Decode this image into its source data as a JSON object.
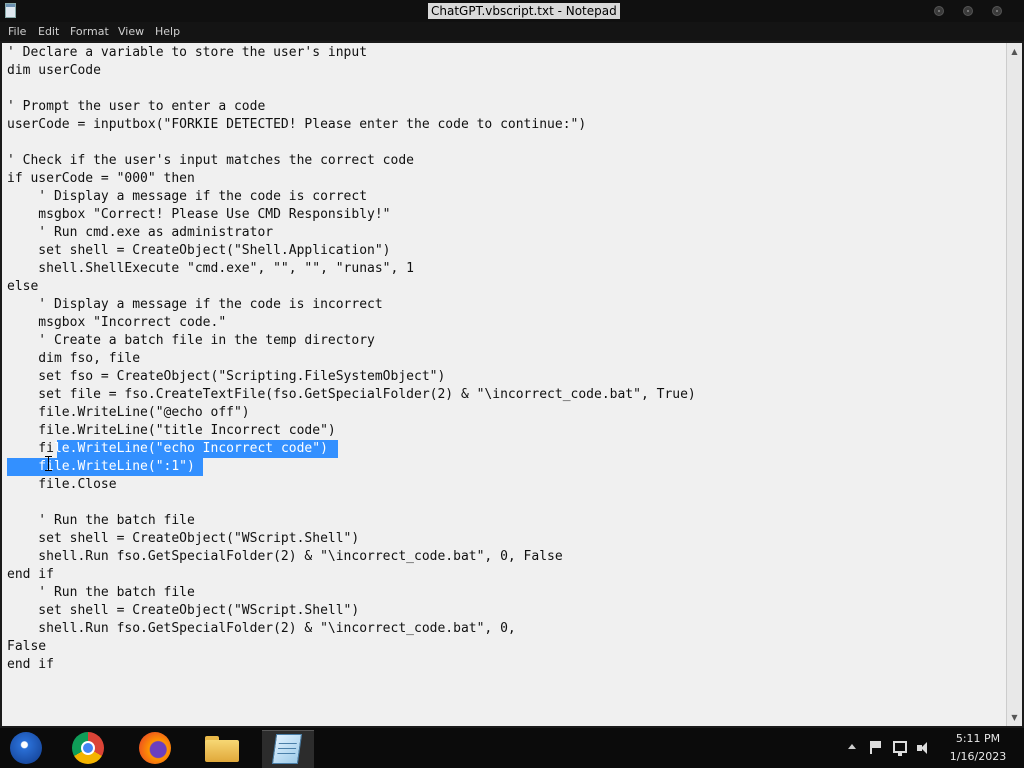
{
  "window": {
    "title": "ChatGPT.vbscript.txt - Notepad"
  },
  "menu": {
    "file": "File",
    "edit": "Edit",
    "format": "Format",
    "view": "View",
    "help": "Help"
  },
  "editor": {
    "lines": [
      "' Declare a variable to store the user's input",
      "dim userCode",
      "",
      "' Prompt the user to enter a code",
      "userCode = inputbox(\"FORKIE DETECTED! Please enter the code to continue:\")",
      "",
      "' Check if the user's input matches the correct code",
      "if userCode = \"000\" then",
      "    ' Display a message if the code is correct",
      "    msgbox \"Correct! Please Use CMD Responsibly!\"",
      "    ' Run cmd.exe as administrator",
      "    set shell = CreateObject(\"Shell.Application\")",
      "    shell.ShellExecute \"cmd.exe\", \"\", \"\", \"runas\", 1",
      "else",
      "    ' Display a message if the code is incorrect",
      "    msgbox \"Incorrect code.\"",
      "    ' Create a batch file in the temp directory",
      "    dim fso, file",
      "    set fso = CreateObject(\"Scripting.FileSystemObject\")",
      "    set file = fso.CreateTextFile(fso.GetSpecialFolder(2) & \"\\incorrect_code.bat\", True)",
      "    file.WriteLine(\"@echo off\")",
      "    file.WriteLine(\"title Incorrect code\")",
      "    fi",
      "",
      "    file.Close",
      "",
      "    ' Run the batch file",
      "    set shell = CreateObject(\"WScript.Shell\")",
      "    shell.Run fso.GetSpecialFolder(2) & \"\\incorrect_code.bat\", 0, False",
      "end if",
      "    ' Run the batch file",
      "    set shell = CreateObject(\"WScript.Shell\")",
      "    shell.Run fso.GetSpecialFolder(2) & \"\\incorrect_code.bat\", 0,",
      "False",
      "end if"
    ],
    "selection": [
      "le.WriteLine(\"echo Incorrect code\")",
      "    file.WriteLine(\":1\")"
    ]
  },
  "taskbar": {
    "apps": [
      "start-button",
      "chrome",
      "firefox",
      "file-explorer",
      "notepad"
    ],
    "clock_time": "5:11 PM",
    "clock_date": "1/16/2023"
  },
  "colors": {
    "selection": "#3390ff",
    "editor_background": "#f0f0f0",
    "taskbar": "#0b0b0b"
  }
}
